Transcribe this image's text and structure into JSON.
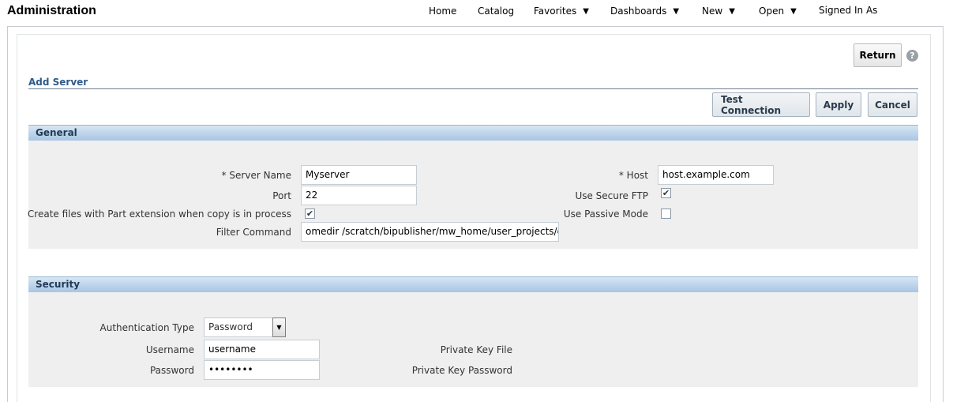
{
  "header": {
    "title": "Administration",
    "nav": {
      "home": "Home",
      "catalog": "Catalog",
      "favorites": "Favorites",
      "dashboards": "Dashboards",
      "new": "New",
      "open": "Open",
      "signed_in_as": "Signed In As"
    }
  },
  "toolbar": {
    "return_label": "Return",
    "help_glyph": "?"
  },
  "page": {
    "title": "Add Server"
  },
  "actions": {
    "test_connection": "Test Connection",
    "apply": "Apply",
    "cancel": "Cancel"
  },
  "general": {
    "header": "General",
    "server_name_label": "* Server Name",
    "server_name_value": "Myserver",
    "port_label": "Port",
    "port_value": "22",
    "part_ext_label": "Create files with Part extension when copy is in process",
    "part_ext_checked": true,
    "filter_command_label": "Filter Command",
    "filter_command_value": "omedir /scratch/bipublisher/mw_home/user_projects/dom",
    "host_label": "* Host",
    "host_value": "host.example.com",
    "secure_ftp_label": "Use Secure FTP",
    "secure_ftp_checked": true,
    "passive_mode_label": "Use Passive Mode",
    "passive_mode_checked": false
  },
  "security": {
    "header": "Security",
    "auth_type_label": "Authentication Type",
    "auth_type_value": "Password",
    "username_label": "Username",
    "username_value": "username",
    "password_label": "Password",
    "password_value": "••••••••",
    "private_key_file_label": "Private Key File",
    "private_key_password_label": "Private Key Password"
  }
}
